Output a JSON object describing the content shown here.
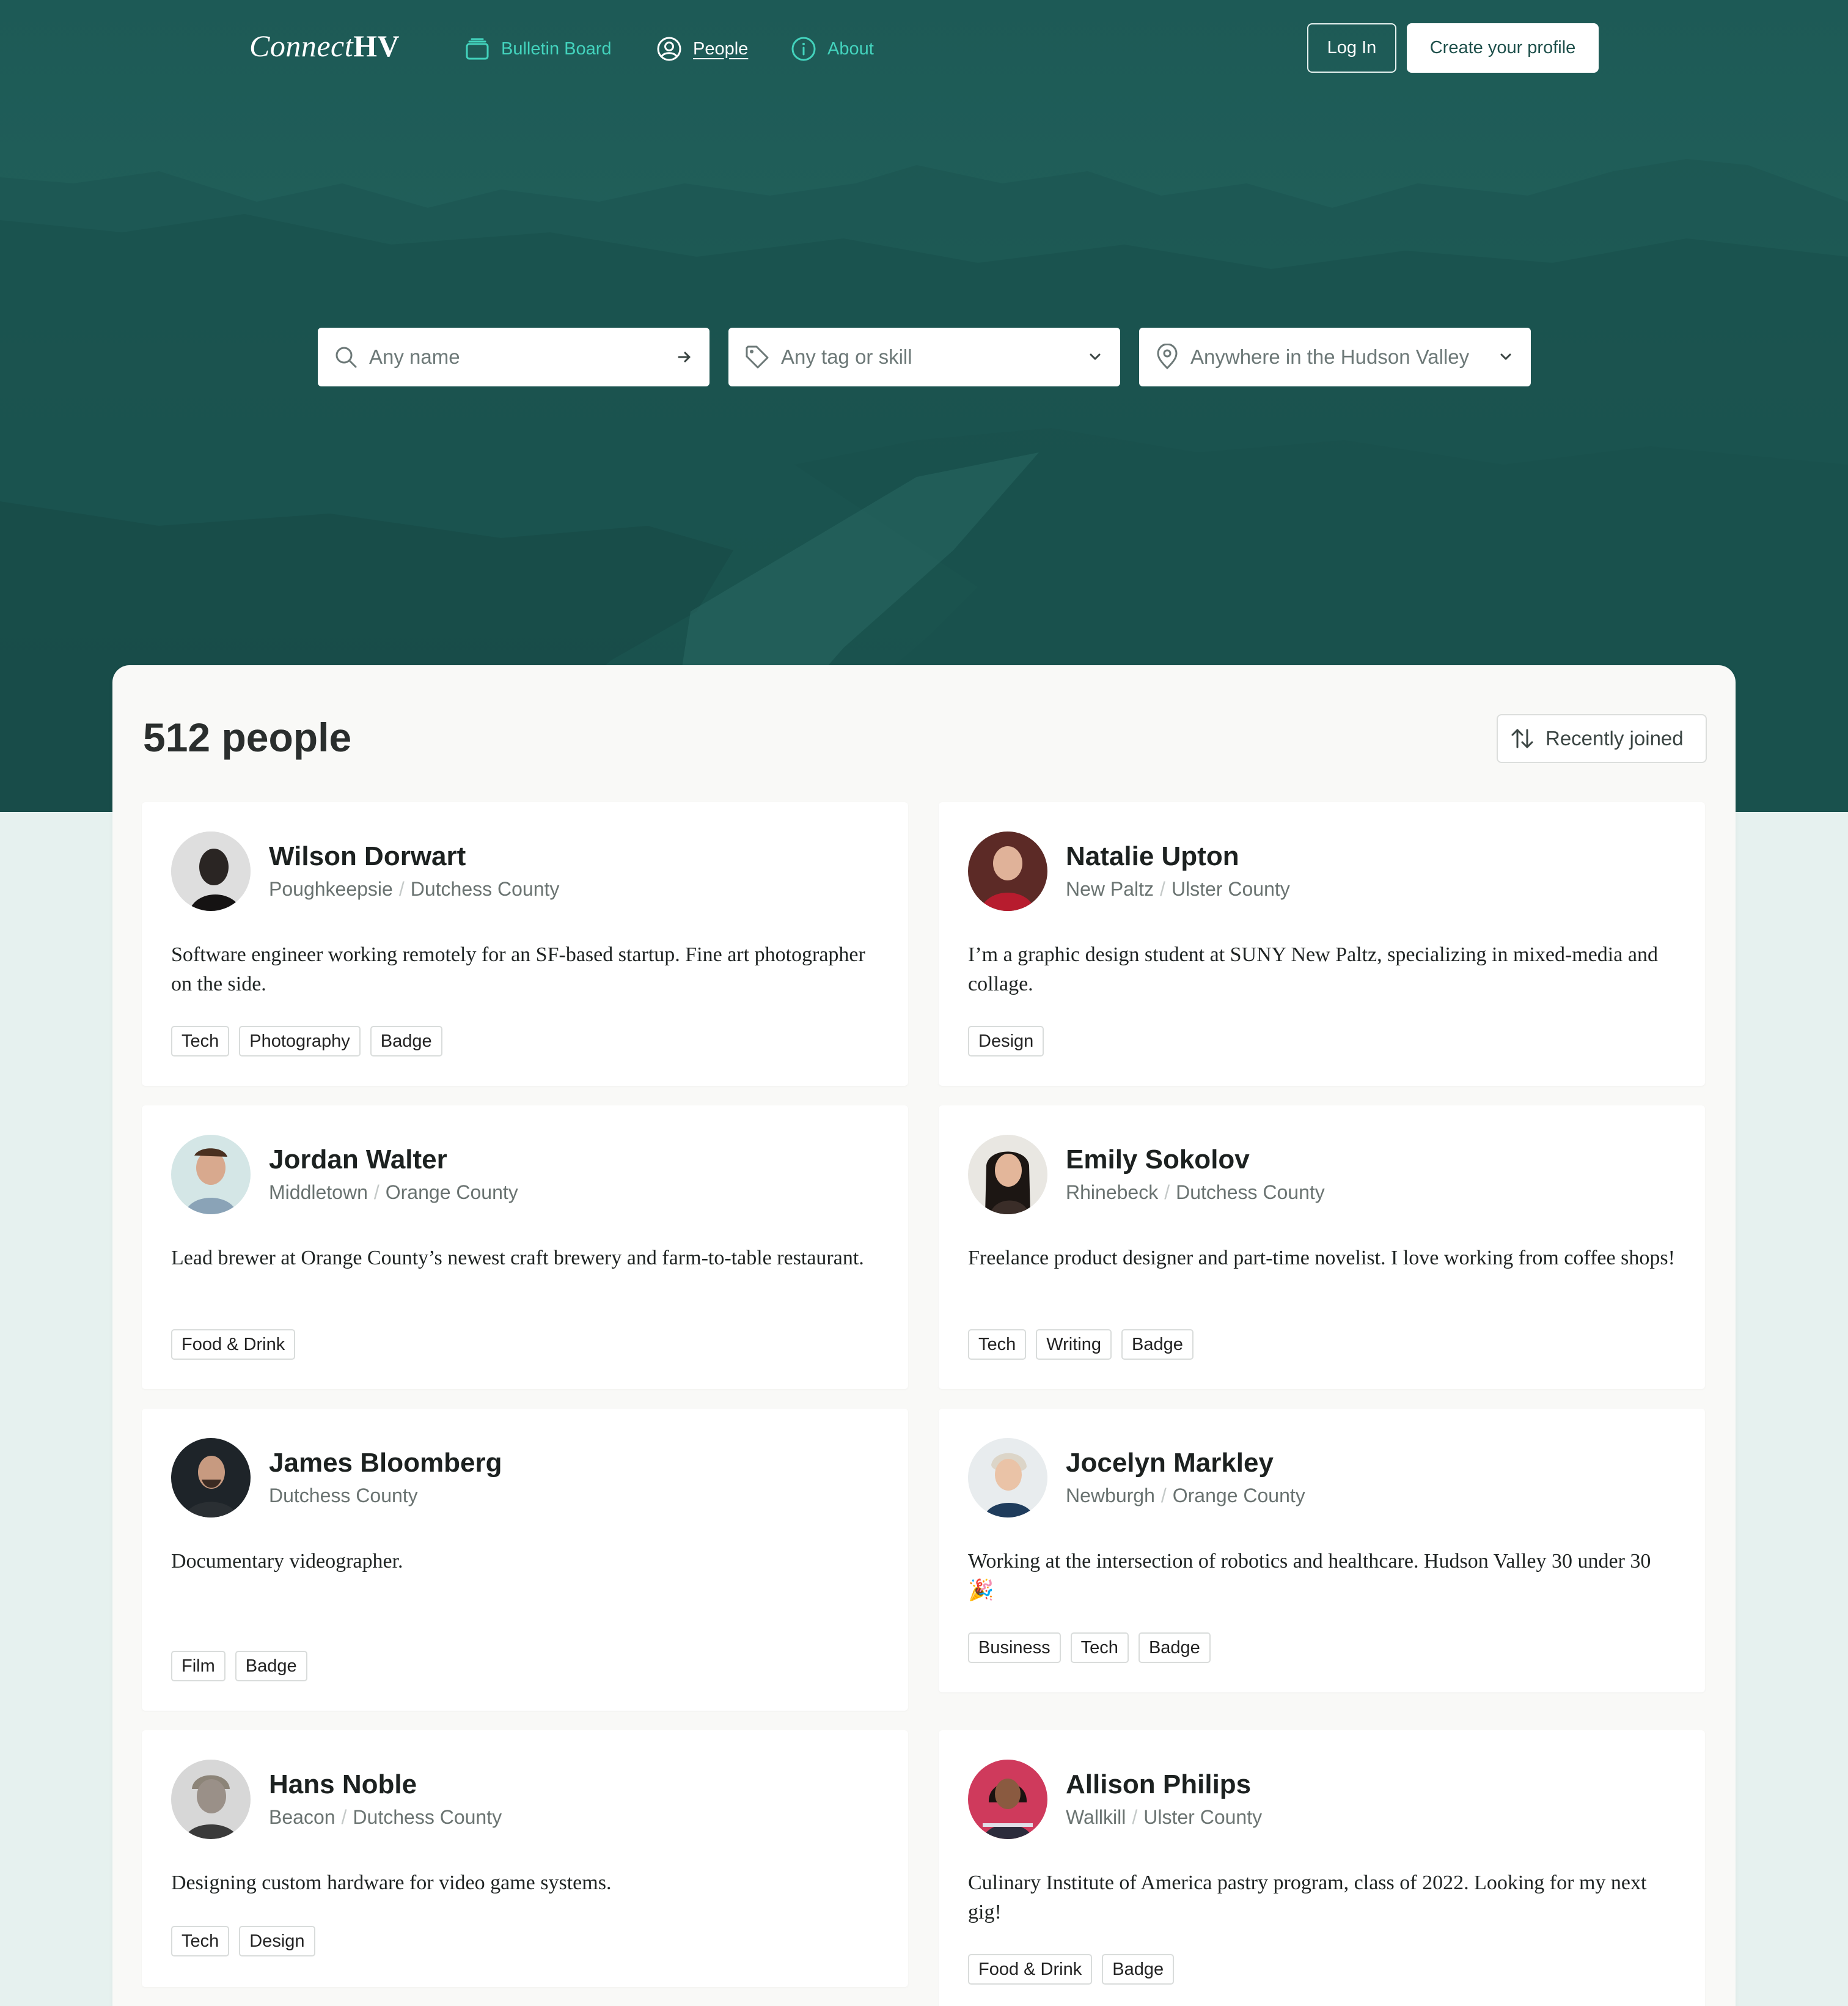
{
  "brand": {
    "logo_light": "Connect",
    "logo_bold": "HV"
  },
  "nav": {
    "items": [
      {
        "label": "Bulletin Board",
        "icon": "bulletin-board-icon"
      },
      {
        "label": "People",
        "icon": "user-circle-icon"
      },
      {
        "label": "About",
        "icon": "info-circle-icon"
      }
    ],
    "login_label": "Log In",
    "create_label": "Create your profile"
  },
  "search": {
    "name_placeholder": "Any name",
    "tag_placeholder": "Any tag or skill",
    "location_placeholder": "Anywhere in the Hudson Valley"
  },
  "results": {
    "count_label": "512 people",
    "sort_label": "Recently joined"
  },
  "colors": {
    "hero": "#1f5c57",
    "accent": "#43d3bd",
    "page_bg": "#e6f1ef",
    "panel_bg": "#f9f9f7"
  },
  "people": [
    {
      "name": "Wilson Dorwart",
      "city": "Poughkeepsie",
      "county": "Dutchess County",
      "bio": "Software engineer working remotely for an SF-based startup. Fine art photographer on the side.",
      "tags": [
        "Tech",
        "Photography",
        "Badge"
      ]
    },
    {
      "name": "Natalie Upton",
      "city": "New Paltz",
      "county": "Ulster County",
      "bio": "I’m a graphic design student at SUNY New Paltz, specializing in mixed-media and collage.",
      "tags": [
        "Design"
      ]
    },
    {
      "name": "Jordan Walter",
      "city": "Middletown",
      "county": "Orange County",
      "bio": "Lead brewer at Orange County’s newest craft brewery and farm-to-table restaurant.",
      "tags": [
        "Food & Drink"
      ]
    },
    {
      "name": "Emily Sokolov",
      "city": "Rhinebeck",
      "county": "Dutchess County",
      "bio": "Freelance product designer and part-time novelist. I love working from coffee shops!",
      "tags": [
        "Tech",
        "Writing",
        "Badge"
      ]
    },
    {
      "name": "James Bloomberg",
      "city": "",
      "county": "Dutchess County",
      "bio": "Documentary videographer.",
      "tags": [
        "Film",
        "Badge"
      ]
    },
    {
      "name": "Jocelyn Markley",
      "city": "Newburgh",
      "county": "Orange County",
      "bio": "Working at the intersection of robotics and healthcare. Hudson Valley 30 under 30 🎉",
      "tags": [
        "Business",
        "Tech",
        "Badge"
      ]
    },
    {
      "name": "Hans Noble",
      "city": "Beacon",
      "county": "Dutchess County",
      "bio": "Designing custom hardware for video game systems.",
      "tags": [
        "Tech",
        "Design"
      ]
    },
    {
      "name": "Allison Philips",
      "city": "Wallkill",
      "county": "Ulster County",
      "bio": "Culinary Institute of America pastry program, class of 2022. Looking for my next gig!",
      "tags": [
        "Food & Drink",
        "Badge"
      ]
    }
  ]
}
